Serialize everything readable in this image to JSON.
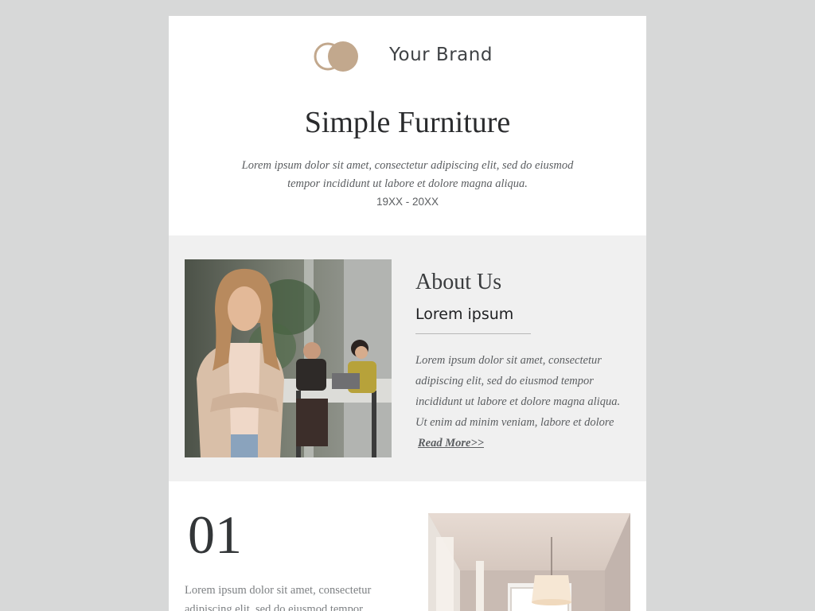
{
  "header": {
    "brand_name": "Your Brand",
    "title": "Simple Furniture",
    "intro": "Lorem ipsum dolor sit amet, consectetur adipiscing elit, sed do eiusmod tempor incididunt ut labore et dolore magna aliqua.",
    "years": "19XX - 20XX"
  },
  "about": {
    "heading": "About Us",
    "subheading": "Lorem ipsum",
    "text": "Lorem ipsum dolor sit amet, consectetur adipiscing elit, sed do eiusmod tempor incididunt ut labore et dolore magna aliqua. Ut enim ad minim veniam, labore et dolore",
    "read_more": "Read More>>"
  },
  "feature": {
    "number": "01",
    "text": "Lorem ipsum dolor sit amet, consectetur adipiscing elit, sed do eiusmod tempor"
  },
  "colors": {
    "page_background": "#d7d8d8",
    "card_background": "#ffffff",
    "section_background": "#f0f0f0",
    "logo_accent": "#c2a88d"
  }
}
